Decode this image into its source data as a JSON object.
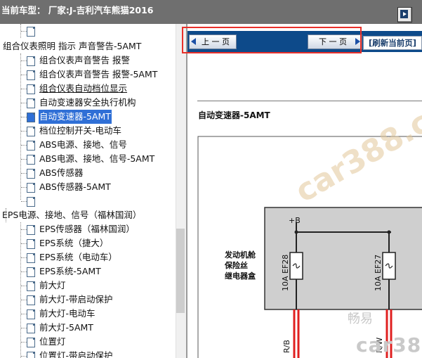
{
  "header": {
    "title": "当前车型： 厂家:J-吉利汽车熊猫2016",
    "toggle_icon": "panel-toggle-icon"
  },
  "tree": {
    "items": [
      {
        "label": "",
        "level": 2
      },
      {
        "label": "组合仪表照明 指示 声音警告-5AMT",
        "level": 0
      },
      {
        "label": "组合仪表声音警告 报警",
        "level": 2
      },
      {
        "label": "组合仪表声音警告 报警-5AMT",
        "level": 2
      },
      {
        "label": "组合仪表自动档位显示",
        "level": 2,
        "underline": true
      },
      {
        "label": "自动变速器安全执行机构",
        "level": 2
      },
      {
        "label": "自动变速器-5AMT",
        "level": 2,
        "selected": true
      },
      {
        "label": "档位控制开关-电动车",
        "level": 2
      },
      {
        "label": "ABS电源、接地、信号",
        "level": 2
      },
      {
        "label": "ABS电源、接地、信号-5AMT",
        "level": 2
      },
      {
        "label": "ABS传感器",
        "level": 2
      },
      {
        "label": "ABS传感器-5AMT",
        "level": 2
      },
      {
        "label": "",
        "level": 2
      },
      {
        "label": "EPS电源、接地、信号（福林国润）",
        "level": 0
      },
      {
        "label": "EPS传感器（福林国润）",
        "level": 2
      },
      {
        "label": "EPS系统（捷大）",
        "level": 2
      },
      {
        "label": "EPS系统（电动车）",
        "level": 2
      },
      {
        "label": "EPS系统-5AMT",
        "level": 2
      },
      {
        "label": "前大灯",
        "level": 2
      },
      {
        "label": "前大灯-带启动保护",
        "level": 2
      },
      {
        "label": "前大灯-电动车",
        "level": 2
      },
      {
        "label": "前大灯-5AMT",
        "level": 2
      },
      {
        "label": "位置灯",
        "level": 2
      },
      {
        "label": "位置灯-带启动保护",
        "level": 2
      }
    ]
  },
  "nav": {
    "prev_label": "上 一 页",
    "next_label": "下 一 页",
    "refresh_label": "[刷新当前页]"
  },
  "diagram": {
    "title": "自动变速器-5AMT",
    "plus_b": "+B",
    "box_label": [
      "发动机舱",
      "保险丝",
      "继电器盒"
    ],
    "fuse1": "10A EF28",
    "fuse2": "10A EF27",
    "wire1": "R/B",
    "wire2": "R/W"
  },
  "watermarks": {
    "main": "car388.com",
    "small": "畅易",
    "bottom": "car388.c"
  },
  "colors": {
    "header_bg": "#6f6f6f",
    "nav_bg": "#0d4a8a",
    "selected_bg": "#2f6fd6",
    "highlight_box": "#e8302a",
    "wire_red": "#e02020",
    "diagram_box": "#cfcfcf"
  }
}
